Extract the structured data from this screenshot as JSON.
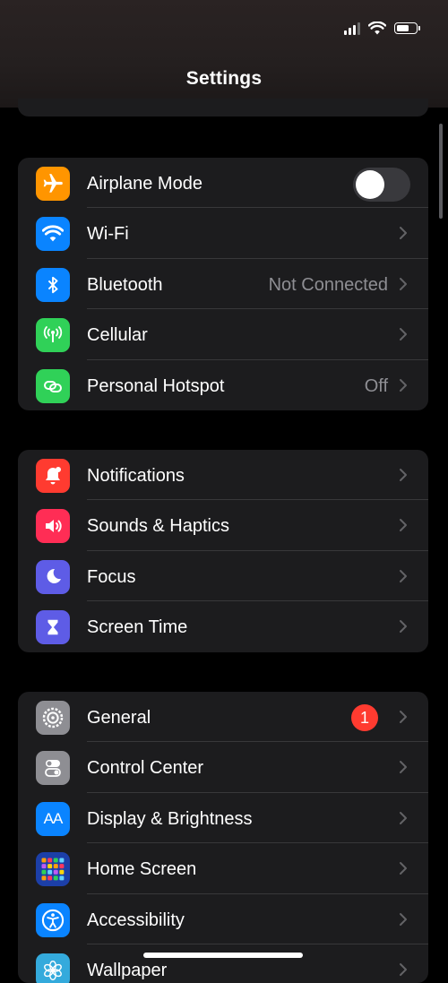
{
  "header": {
    "title": "Settings"
  },
  "status_bar": {
    "icons": [
      "cellular-signal-icon",
      "wifi-icon",
      "battery-icon"
    ],
    "battery_fraction": 0.7
  },
  "groups": [
    {
      "items": [
        {
          "label": "Airplane Mode",
          "icon": "airplane-icon",
          "icon_color": "#ff9500",
          "control": "toggle",
          "toggle_on": false
        },
        {
          "label": "Wi-Fi",
          "icon": "wifi-icon",
          "icon_color": "#0a84ff",
          "value": ""
        },
        {
          "label": "Bluetooth",
          "icon": "bluetooth-icon",
          "icon_color": "#0a84ff",
          "value": "Not Connected"
        },
        {
          "label": "Cellular",
          "icon": "cellular-antenna-icon",
          "icon_color": "#30d158",
          "value": ""
        },
        {
          "label": "Personal Hotspot",
          "icon": "hotspot-icon",
          "icon_color": "#30d158",
          "value": "Off"
        }
      ]
    },
    {
      "items": [
        {
          "label": "Notifications",
          "icon": "bell-icon",
          "icon_color": "#ff3b30"
        },
        {
          "label": "Sounds & Haptics",
          "icon": "speaker-icon",
          "icon_color": "#ff2d55"
        },
        {
          "label": "Focus",
          "icon": "moon-icon",
          "icon_color": "#5e5ce6"
        },
        {
          "label": "Screen Time",
          "icon": "hourglass-icon",
          "icon_color": "#5e5ce6"
        }
      ]
    },
    {
      "items": [
        {
          "label": "General",
          "icon": "gear-icon",
          "icon_color": "#8e8e93",
          "badge": "1"
        },
        {
          "label": "Control Center",
          "icon": "switches-icon",
          "icon_color": "#8e8e93"
        },
        {
          "label": "Display & Brightness",
          "icon": "text-size-icon",
          "icon_color": "#0a84ff",
          "icon_text": "AA"
        },
        {
          "label": "Home Screen",
          "icon": "app-grid-icon",
          "icon_color": "#1c3fa8"
        },
        {
          "label": "Accessibility",
          "icon": "accessibility-icon",
          "icon_color": "#0a84ff"
        },
        {
          "label": "Wallpaper",
          "icon": "flower-icon",
          "icon_color": "#34aadc"
        }
      ]
    }
  ]
}
